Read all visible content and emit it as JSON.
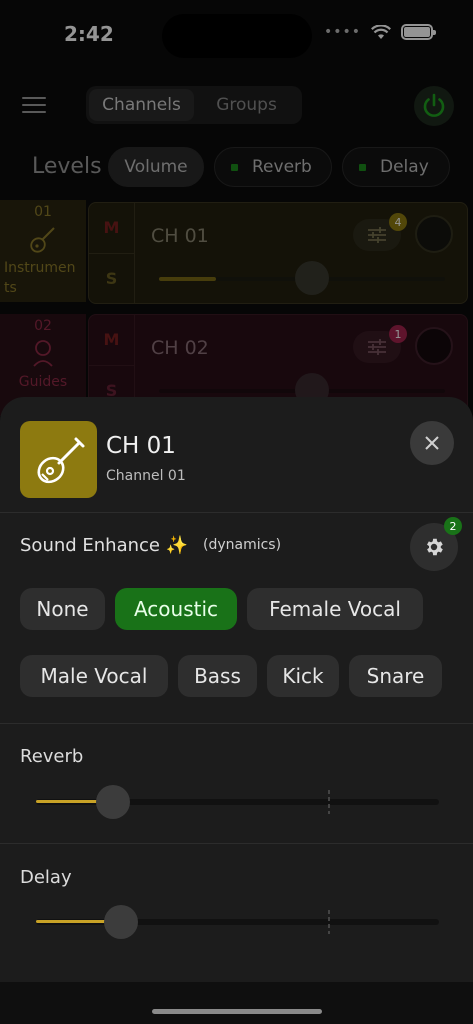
{
  "status_bar": {
    "time": "2:42"
  },
  "header": {
    "tabs": [
      {
        "label": "Channels",
        "active": true
      },
      {
        "label": "Groups",
        "active": false
      }
    ]
  },
  "levels": {
    "label": "Levels",
    "options": [
      {
        "label": "Volume"
      },
      {
        "label": "Reverb"
      },
      {
        "label": "Delay"
      }
    ]
  },
  "groups": [
    {
      "number": "01",
      "name": "Instrumen ts",
      "color": "#8c7a2a"
    },
    {
      "number": "02",
      "name": "Guides",
      "color": "#8f2a45"
    }
  ],
  "channels": [
    {
      "name": "CH 01",
      "mute": "M",
      "solo": "S",
      "eq_badge": "4",
      "volume_level": 0.2
    },
    {
      "name": "CH 02",
      "mute": "M",
      "solo": "S",
      "eq_badge": "1",
      "volume_level": 0.2
    }
  ],
  "sheet": {
    "title": "CH 01",
    "subtitle": "Channel 01",
    "sound_enhance": {
      "label": "Sound Enhance ✨",
      "sublabel": "(dynamics)",
      "settings_badge": "2",
      "presets": [
        {
          "label": "None",
          "active": false
        },
        {
          "label": "Acoustic",
          "active": true
        },
        {
          "label": "Female Vocal",
          "active": false
        },
        {
          "label": "Male Vocal",
          "active": false
        },
        {
          "label": "Bass",
          "active": false
        },
        {
          "label": "Kick",
          "active": false
        },
        {
          "label": "Snare",
          "active": false
        }
      ]
    },
    "reverb": {
      "label": "Reverb",
      "level": 0.19
    },
    "delay": {
      "label": "Delay",
      "level": 0.21
    }
  },
  "colors": {
    "accent_green": "#197218",
    "accent_gold": "#8d7a10",
    "slider_fill": "#c8a226"
  },
  "icons": {
    "menu": "menu-icon",
    "power": "power-icon",
    "guitar": "guitar-icon",
    "close": "close-icon",
    "settings": "gear-icon",
    "eq": "sliders-icon"
  }
}
